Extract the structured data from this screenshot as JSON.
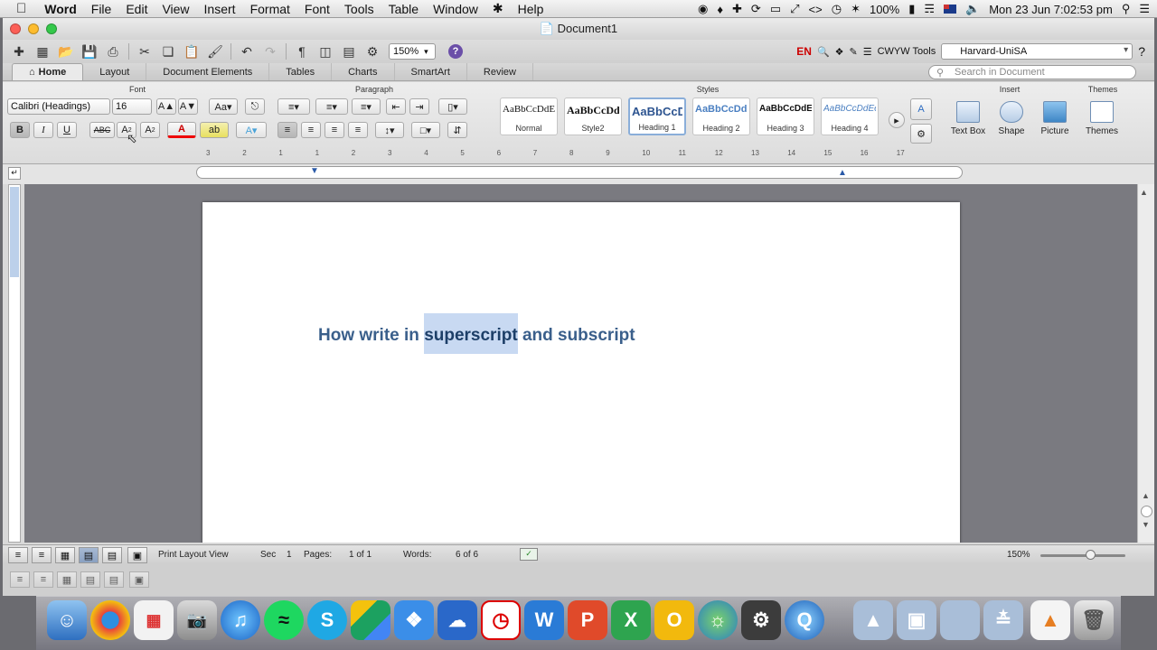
{
  "menubar": {
    "app": "Word",
    "items": [
      "File",
      "Edit",
      "View",
      "Insert",
      "Format",
      "Font",
      "Tools",
      "Table",
      "Window",
      "Help"
    ],
    "battery": "100%",
    "clock": "Mon 23 Jun  7:02:53 pm"
  },
  "window": {
    "title": "Document1"
  },
  "toolbar": {
    "zoom": "150%",
    "help": "?",
    "language": "EN",
    "cwyw": "CWYW Tools",
    "citation_style": "Harvard-UniSA",
    "search_placeholder": "Search in Document"
  },
  "ribbon_tabs": [
    "Home",
    "Layout",
    "Document Elements",
    "Tables",
    "Charts",
    "SmartArt",
    "Review"
  ],
  "ribbon": {
    "groups": {
      "font": "Font",
      "paragraph": "Paragraph",
      "styles": "Styles",
      "insert": "Insert",
      "themes": "Themes"
    },
    "font_name": "Calibri (Headings)",
    "font_size": "16",
    "format_buttons": {
      "bold": "B",
      "italic": "I",
      "underline": "U",
      "strike": "ABC",
      "superscript": "A",
      "subscript": "A"
    },
    "styles": [
      {
        "preview": "AaBbCcDdE",
        "name": "Normal"
      },
      {
        "preview": "AaBbCcDd",
        "name": "Style2"
      },
      {
        "preview": "AaBbCcD",
        "name": "Heading 1"
      },
      {
        "preview": "AaBbCcDdE",
        "name": "Heading 2"
      },
      {
        "preview": "AaBbCcDdEe",
        "name": "Heading 3"
      },
      {
        "preview": "AaBbCcDdEe",
        "name": "Heading 4"
      }
    ],
    "insert_items": [
      "Text Box",
      "Shape",
      "Picture"
    ],
    "themes_label": "Themes"
  },
  "ruler": {
    "ticks": [
      "3",
      "2",
      "1",
      "1",
      "2",
      "3",
      "4",
      "5",
      "6",
      "7",
      "8",
      "9",
      "10",
      "11",
      "12",
      "13",
      "14",
      "15",
      "16",
      "17"
    ]
  },
  "document": {
    "text_before": "How write in ",
    "text_selected": "superscript",
    "text_after": " and subscript"
  },
  "statusbar": {
    "view": "Print Layout View",
    "sec_label": "Sec",
    "sec_value": "1",
    "pages_label": "Pages:",
    "pages_value": "1 of 1",
    "words_label": "Words:",
    "words_value": "6 of 6",
    "zoom": "150%"
  },
  "colors": {
    "heading": "#3a5f8b",
    "selection": "#c8d9f2",
    "accent": "#6b4fa8"
  }
}
